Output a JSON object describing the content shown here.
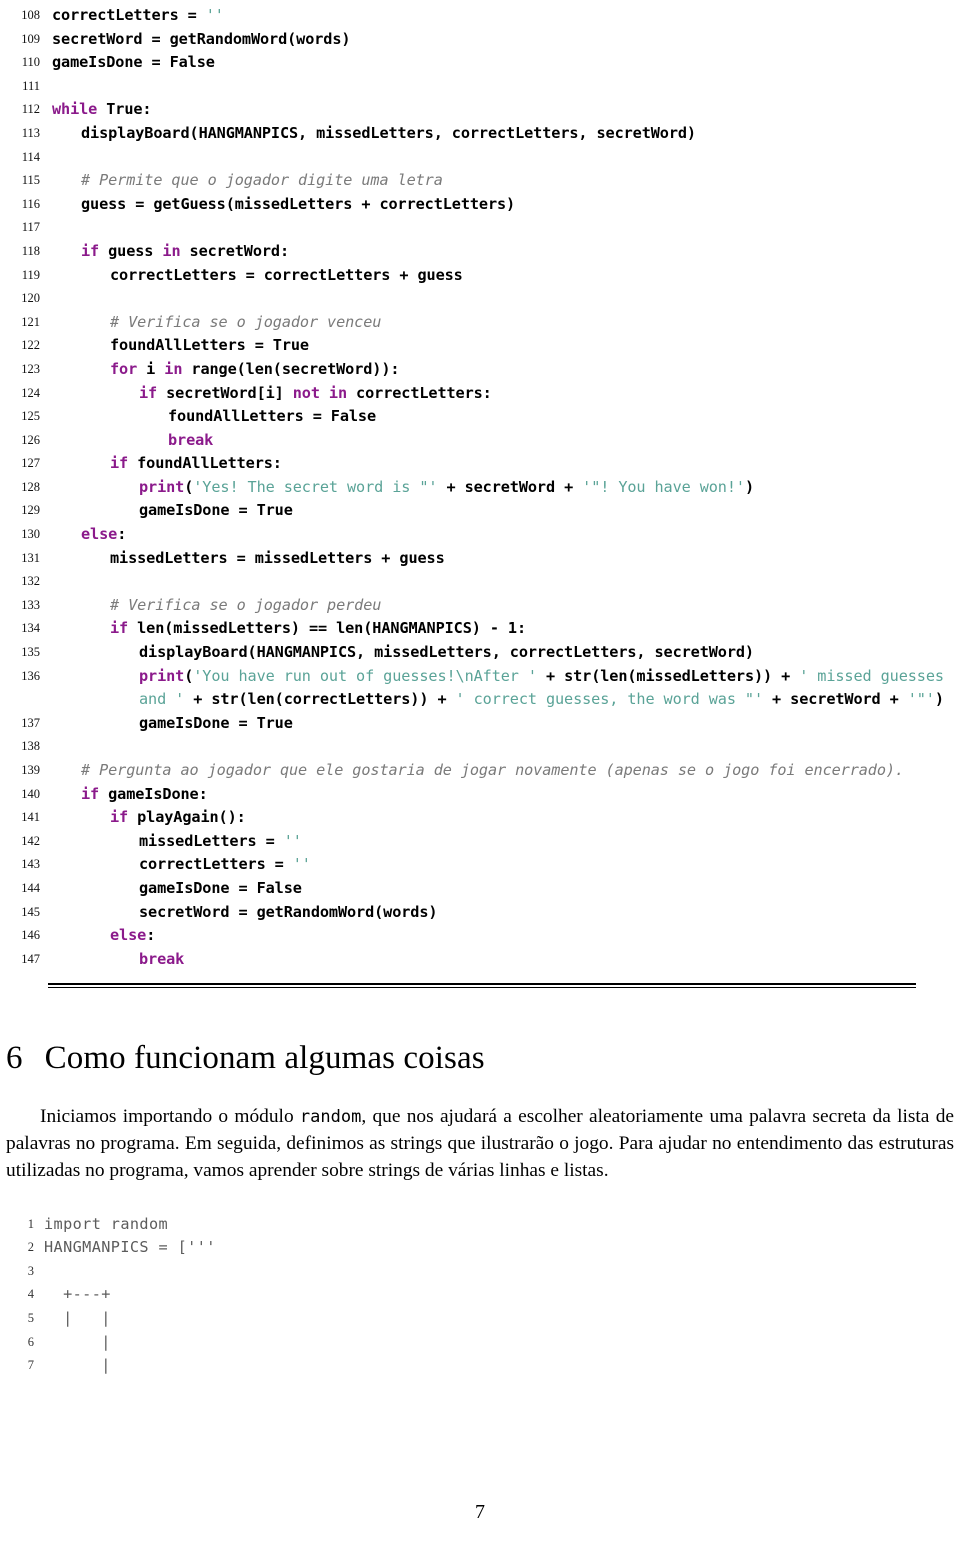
{
  "document": {
    "page_number": "7",
    "language": "pt-BR"
  },
  "listing_main": {
    "lines": [
      {
        "no": "108",
        "indent": 0,
        "tokens": [
          {
            "t": "correctLetters = ",
            "c": "plain"
          },
          {
            "t": "''",
            "c": "str"
          }
        ]
      },
      {
        "no": "109",
        "indent": 0,
        "tokens": [
          {
            "t": "secretWord = getRandomWord(words)",
            "c": "plain"
          }
        ]
      },
      {
        "no": "110",
        "indent": 0,
        "tokens": [
          {
            "t": "gameIsDone = False",
            "c": "plain"
          }
        ]
      },
      {
        "no": "111",
        "indent": 0,
        "tokens": []
      },
      {
        "no": "112",
        "indent": 0,
        "tokens": [
          {
            "t": "while",
            "c": "kw"
          },
          {
            "t": " True:",
            "c": "plain"
          }
        ]
      },
      {
        "no": "113",
        "indent": 1,
        "tokens": [
          {
            "t": "displayBoard(HANGMANPICS, missedLetters, correctLetters, secretWord)",
            "c": "plain"
          }
        ]
      },
      {
        "no": "114",
        "indent": 0,
        "tokens": []
      },
      {
        "no": "115",
        "indent": 1,
        "tokens": [
          {
            "t": "# Permite que o jogador digite uma letra",
            "c": "cmt"
          }
        ]
      },
      {
        "no": "116",
        "indent": 1,
        "tokens": [
          {
            "t": "guess = getGuess(missedLetters + correctLetters)",
            "c": "plain"
          }
        ]
      },
      {
        "no": "117",
        "indent": 0,
        "tokens": []
      },
      {
        "no": "118",
        "indent": 1,
        "tokens": [
          {
            "t": "if",
            "c": "kw"
          },
          {
            "t": " guess ",
            "c": "plain"
          },
          {
            "t": "in",
            "c": "kw"
          },
          {
            "t": " secretWord:",
            "c": "plain"
          }
        ]
      },
      {
        "no": "119",
        "indent": 2,
        "tokens": [
          {
            "t": "correctLetters = correctLetters + guess",
            "c": "plain"
          }
        ]
      },
      {
        "no": "120",
        "indent": 0,
        "tokens": []
      },
      {
        "no": "121",
        "indent": 2,
        "tokens": [
          {
            "t": "# Verifica se o jogador venceu",
            "c": "cmt"
          }
        ]
      },
      {
        "no": "122",
        "indent": 2,
        "tokens": [
          {
            "t": "foundAllLetters = True",
            "c": "plain"
          }
        ]
      },
      {
        "no": "123",
        "indent": 2,
        "tokens": [
          {
            "t": "for",
            "c": "kw"
          },
          {
            "t": " i ",
            "c": "plain"
          },
          {
            "t": "in",
            "c": "kw"
          },
          {
            "t": " range(len(secretWord)):",
            "c": "plain"
          }
        ]
      },
      {
        "no": "124",
        "indent": 3,
        "tokens": [
          {
            "t": "if",
            "c": "kw"
          },
          {
            "t": " secretWord[i] ",
            "c": "plain"
          },
          {
            "t": "not in",
            "c": "kw"
          },
          {
            "t": " correctLetters:",
            "c": "plain"
          }
        ]
      },
      {
        "no": "125",
        "indent": 4,
        "tokens": [
          {
            "t": "foundAllLetters = False",
            "c": "plain"
          }
        ]
      },
      {
        "no": "126",
        "indent": 4,
        "tokens": [
          {
            "t": "break",
            "c": "kw"
          }
        ]
      },
      {
        "no": "127",
        "indent": 2,
        "tokens": [
          {
            "t": "if",
            "c": "kw"
          },
          {
            "t": " foundAllLetters:",
            "c": "plain"
          }
        ]
      },
      {
        "no": "128",
        "indent": 3,
        "tokens": [
          {
            "t": "print",
            "c": "kw"
          },
          {
            "t": "(",
            "c": "plain"
          },
          {
            "t": "'Yes! The secret word is \"'",
            "c": "str"
          },
          {
            "t": " + secretWord + ",
            "c": "plain"
          },
          {
            "t": "'\"! You have won!'",
            "c": "str"
          },
          {
            "t": ")",
            "c": "plain"
          }
        ]
      },
      {
        "no": "129",
        "indent": 3,
        "tokens": [
          {
            "t": "gameIsDone = True",
            "c": "plain"
          }
        ]
      },
      {
        "no": "130",
        "indent": 1,
        "tokens": [
          {
            "t": "else",
            "c": "kw"
          },
          {
            "t": ":",
            "c": "plain"
          }
        ]
      },
      {
        "no": "131",
        "indent": 2,
        "tokens": [
          {
            "t": "missedLetters = missedLetters + guess",
            "c": "plain"
          }
        ]
      },
      {
        "no": "132",
        "indent": 0,
        "tokens": []
      },
      {
        "no": "133",
        "indent": 2,
        "tokens": [
          {
            "t": "# Verifica se o jogador perdeu",
            "c": "cmt"
          }
        ]
      },
      {
        "no": "134",
        "indent": 2,
        "tokens": [
          {
            "t": "if",
            "c": "kw"
          },
          {
            "t": " len(missedLetters) == len(HANGMANPICS) - 1:",
            "c": "plain"
          }
        ]
      },
      {
        "no": "135",
        "indent": 3,
        "tokens": [
          {
            "t": "displayBoard(HANGMANPICS, missedLetters, correctLetters, secretWord)",
            "c": "plain"
          }
        ]
      },
      {
        "no": "136",
        "indent": 3,
        "tokens": [
          {
            "t": "print",
            "c": "kw"
          },
          {
            "t": "(",
            "c": "plain"
          },
          {
            "t": "'You have run out of guesses!\\nAfter '",
            "c": "str"
          },
          {
            "t": " + str(len(missedLetters)) + ",
            "c": "plain"
          },
          {
            "t": "' missed guesses and '",
            "c": "str"
          },
          {
            "t": " + str(len(correctLetters)) + ",
            "c": "plain"
          },
          {
            "t": "' correct guesses, the word was \"'",
            "c": "str"
          },
          {
            "t": " + secretWord + ",
            "c": "plain"
          },
          {
            "t": "'\"'",
            "c": "str"
          },
          {
            "t": ")",
            "c": "plain"
          }
        ]
      },
      {
        "no": "137",
        "indent": 3,
        "tokens": [
          {
            "t": "gameIsDone = True",
            "c": "plain"
          }
        ]
      },
      {
        "no": "138",
        "indent": 0,
        "tokens": []
      },
      {
        "no": "139",
        "indent": 1,
        "tokens": [
          {
            "t": "# Pergunta ao jogador que ele gostaria de jogar novamente (apenas se o jogo foi encerrado).",
            "c": "cmt"
          }
        ]
      },
      {
        "no": "140",
        "indent": 1,
        "tokens": [
          {
            "t": "if",
            "c": "kw"
          },
          {
            "t": " gameIsDone:",
            "c": "plain"
          }
        ]
      },
      {
        "no": "141",
        "indent": 2,
        "tokens": [
          {
            "t": "if",
            "c": "kw"
          },
          {
            "t": " playAgain():",
            "c": "plain"
          }
        ]
      },
      {
        "no": "142",
        "indent": 3,
        "tokens": [
          {
            "t": "missedLetters = ",
            "c": "plain"
          },
          {
            "t": "''",
            "c": "str"
          }
        ]
      },
      {
        "no": "143",
        "indent": 3,
        "tokens": [
          {
            "t": "correctLetters = ",
            "c": "plain"
          },
          {
            "t": "''",
            "c": "str"
          }
        ]
      },
      {
        "no": "144",
        "indent": 3,
        "tokens": [
          {
            "t": "gameIsDone = False",
            "c": "plain"
          }
        ]
      },
      {
        "no": "145",
        "indent": 3,
        "tokens": [
          {
            "t": "secretWord = getRandomWord(words)",
            "c": "plain"
          }
        ]
      },
      {
        "no": "146",
        "indent": 2,
        "tokens": [
          {
            "t": "else",
            "c": "kw"
          },
          {
            "t": ":",
            "c": "plain"
          }
        ]
      },
      {
        "no": "147",
        "indent": 3,
        "tokens": [
          {
            "t": "break",
            "c": "kw"
          }
        ]
      }
    ]
  },
  "section": {
    "number": "6",
    "title": "Como funcionam algumas coisas"
  },
  "paragraph": {
    "part1": "Iniciamos importando o módulo ",
    "mono": "random",
    "part2": ", que nos ajudará a escolher aleatoriamente uma palavra secreta da lista de palavras no programa.  Em seguida, definimos as strings que ilustrarão o jogo. Para ajudar no entendimento das estruturas utilizadas no programa, vamos aprender sobre strings de várias linhas e listas."
  },
  "listing_second": {
    "lines": [
      {
        "no": "1",
        "text": "import random"
      },
      {
        "no": "2",
        "text": "HANGMANPICS = ['''"
      },
      {
        "no": "3",
        "text": ""
      },
      {
        "no": "4",
        "text": "  +---+"
      },
      {
        "no": "5",
        "text": "  |   |"
      },
      {
        "no": "6",
        "text": "      |"
      },
      {
        "no": "7",
        "text": "      |"
      }
    ]
  },
  "colors": {
    "keyword": "#8b1a8b",
    "string": "#5aa397",
    "comment": "#7a7a7a",
    "code_text": "#000000",
    "second_listing": "#5c5c5c",
    "background": "#ffffff"
  }
}
